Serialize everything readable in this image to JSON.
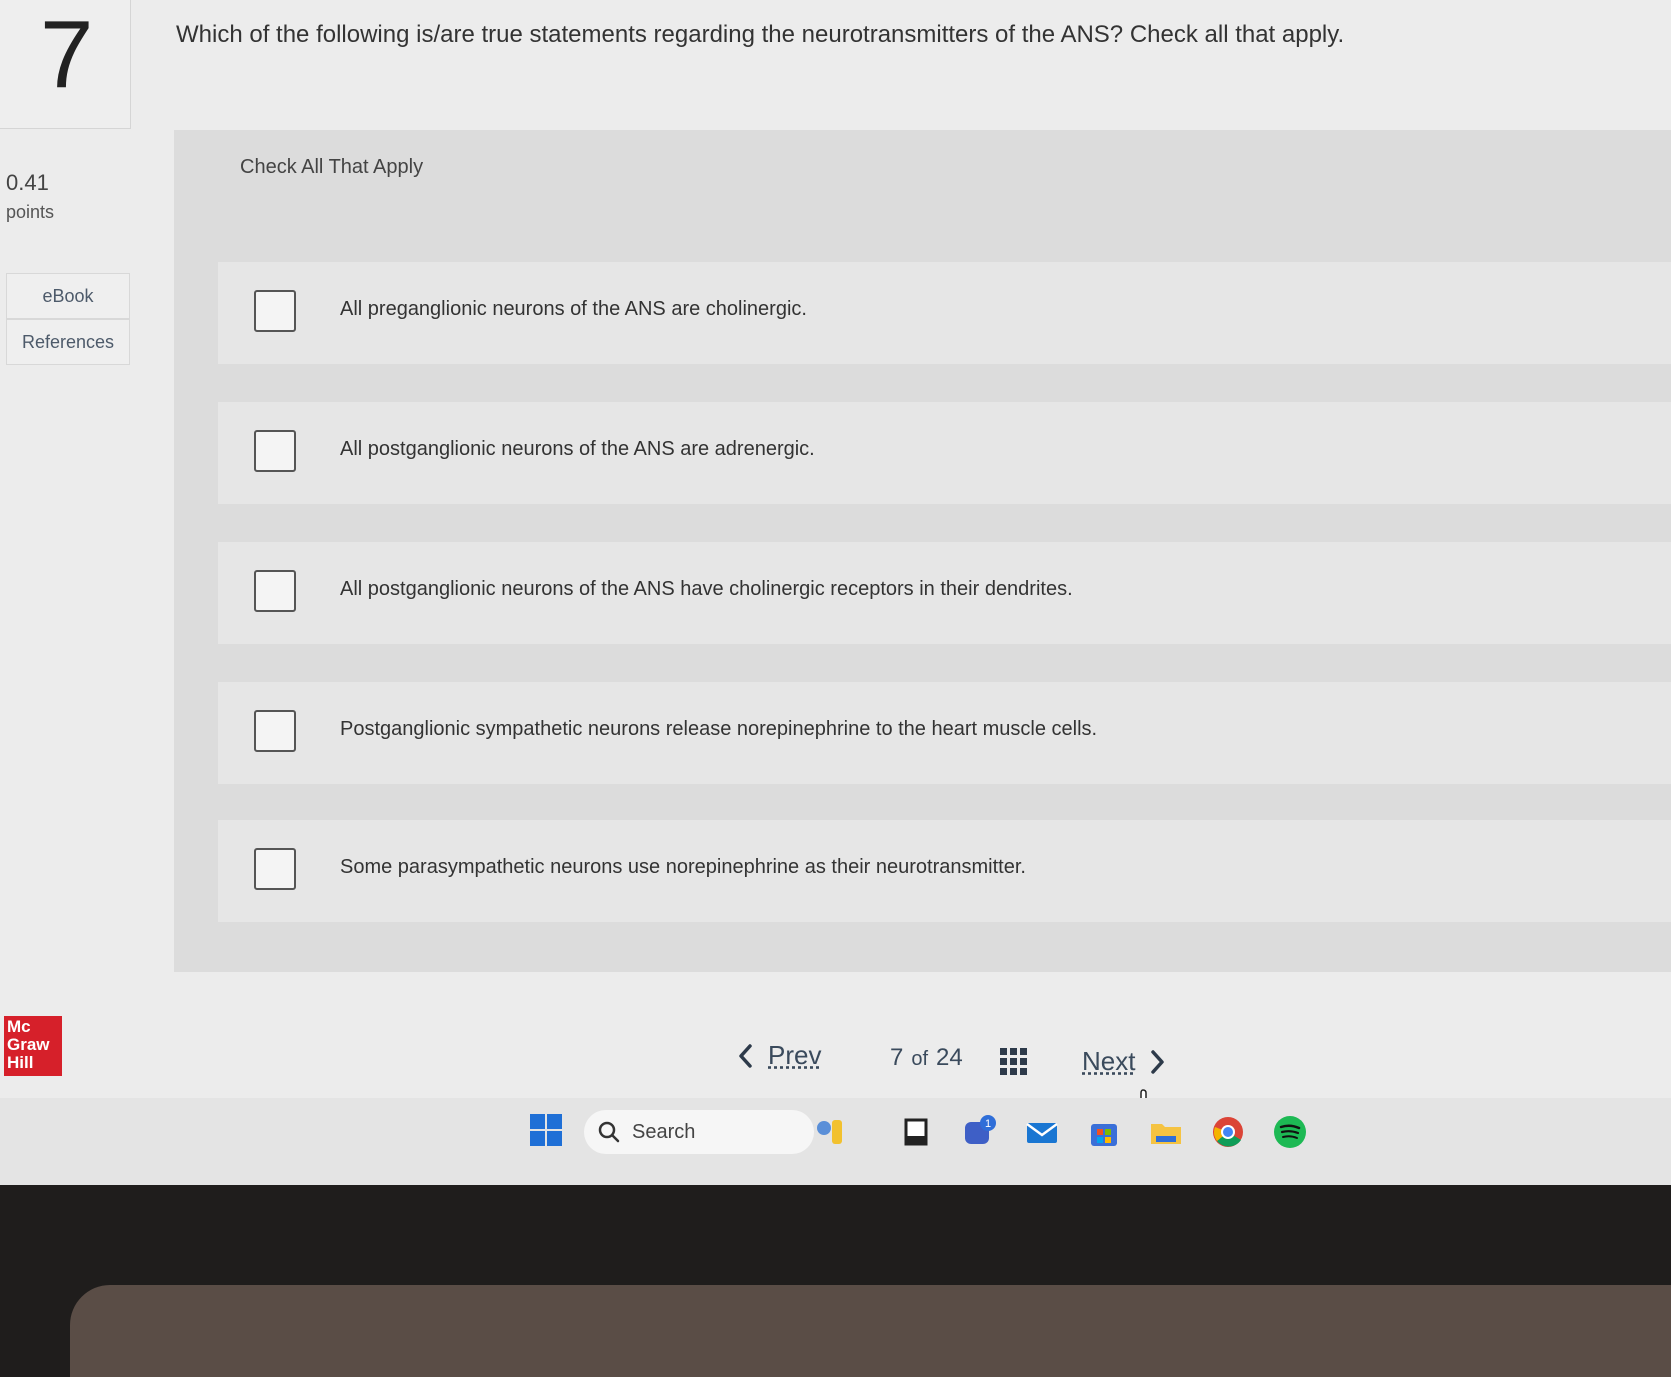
{
  "question": {
    "number": "7",
    "points_value": "0.41",
    "points_label": "points",
    "text": "Which of the following is/are true statements regarding the neurotransmitters of the ANS? Check all that apply."
  },
  "sidebar": {
    "ebook_label": "eBook",
    "references_label": "References"
  },
  "answers": {
    "instruction": "Check All That Apply",
    "options": [
      {
        "label": "All preganglionic neurons of the ANS are cholinergic.",
        "checked": false
      },
      {
        "label": "All postganglionic neurons of the ANS are adrenergic.",
        "checked": false
      },
      {
        "label": "All postganglionic neurons of the ANS have cholinergic receptors in their dendrites.",
        "checked": false
      },
      {
        "label": "Postganglionic sympathetic neurons release norepinephrine to the heart muscle cells.",
        "checked": false
      },
      {
        "label": "Some parasympathetic neurons use norepinephrine as their neurotransmitter.",
        "checked": false
      }
    ]
  },
  "branding": {
    "logo_line1": "Mc",
    "logo_line2": "Graw",
    "logo_line3": "Hill",
    "logo_color": "#d6202a"
  },
  "navigation": {
    "prev_label": "Prev",
    "current_page": "7",
    "of_label": "of",
    "total_pages": "24",
    "next_label": "Next"
  },
  "taskbar": {
    "search_placeholder": "Search",
    "notification_badge": "1",
    "icons": [
      "windows-start-icon",
      "search-icon",
      "widgets-icon",
      "file-icon",
      "chat-icon",
      "mail-icon",
      "store-icon",
      "folder-icon",
      "chrome-icon",
      "spotify-icon"
    ]
  }
}
